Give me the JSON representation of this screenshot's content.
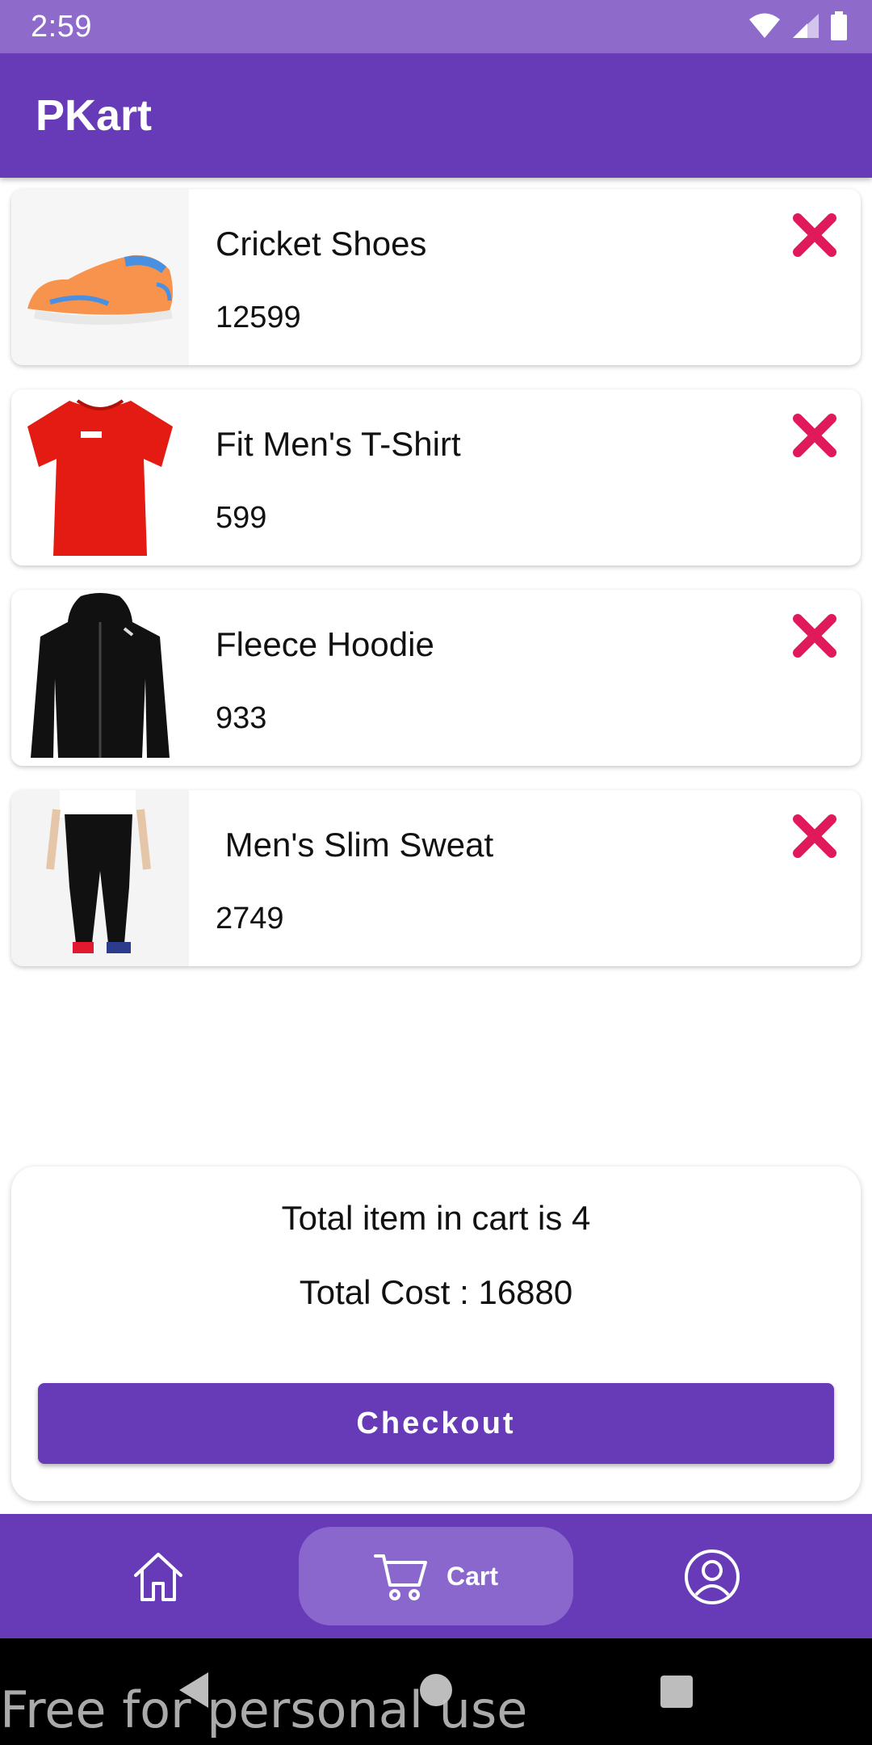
{
  "status_bar": {
    "time": "2:59"
  },
  "app_bar": {
    "title": "PKart"
  },
  "cart_items": [
    {
      "name": "Cricket Shoes",
      "price": "12599"
    },
    {
      "name": "Fit Men's T-Shirt",
      "price": "599"
    },
    {
      "name": "Fleece Hoodie",
      "price": "933"
    },
    {
      "name": " Men's Slim Sweat",
      "price": "2749"
    }
  ],
  "summary": {
    "total_items": "Total item in cart is 4",
    "total_cost": "Total Cost : 16880",
    "checkout_label": "Checkout"
  },
  "bottom_nav": {
    "cart_label": "Cart"
  },
  "watermark": "Free for personal use",
  "colors": {
    "primary": "#673ab7",
    "status_bar": "#8e6bcb",
    "remove": "#e0195a"
  }
}
